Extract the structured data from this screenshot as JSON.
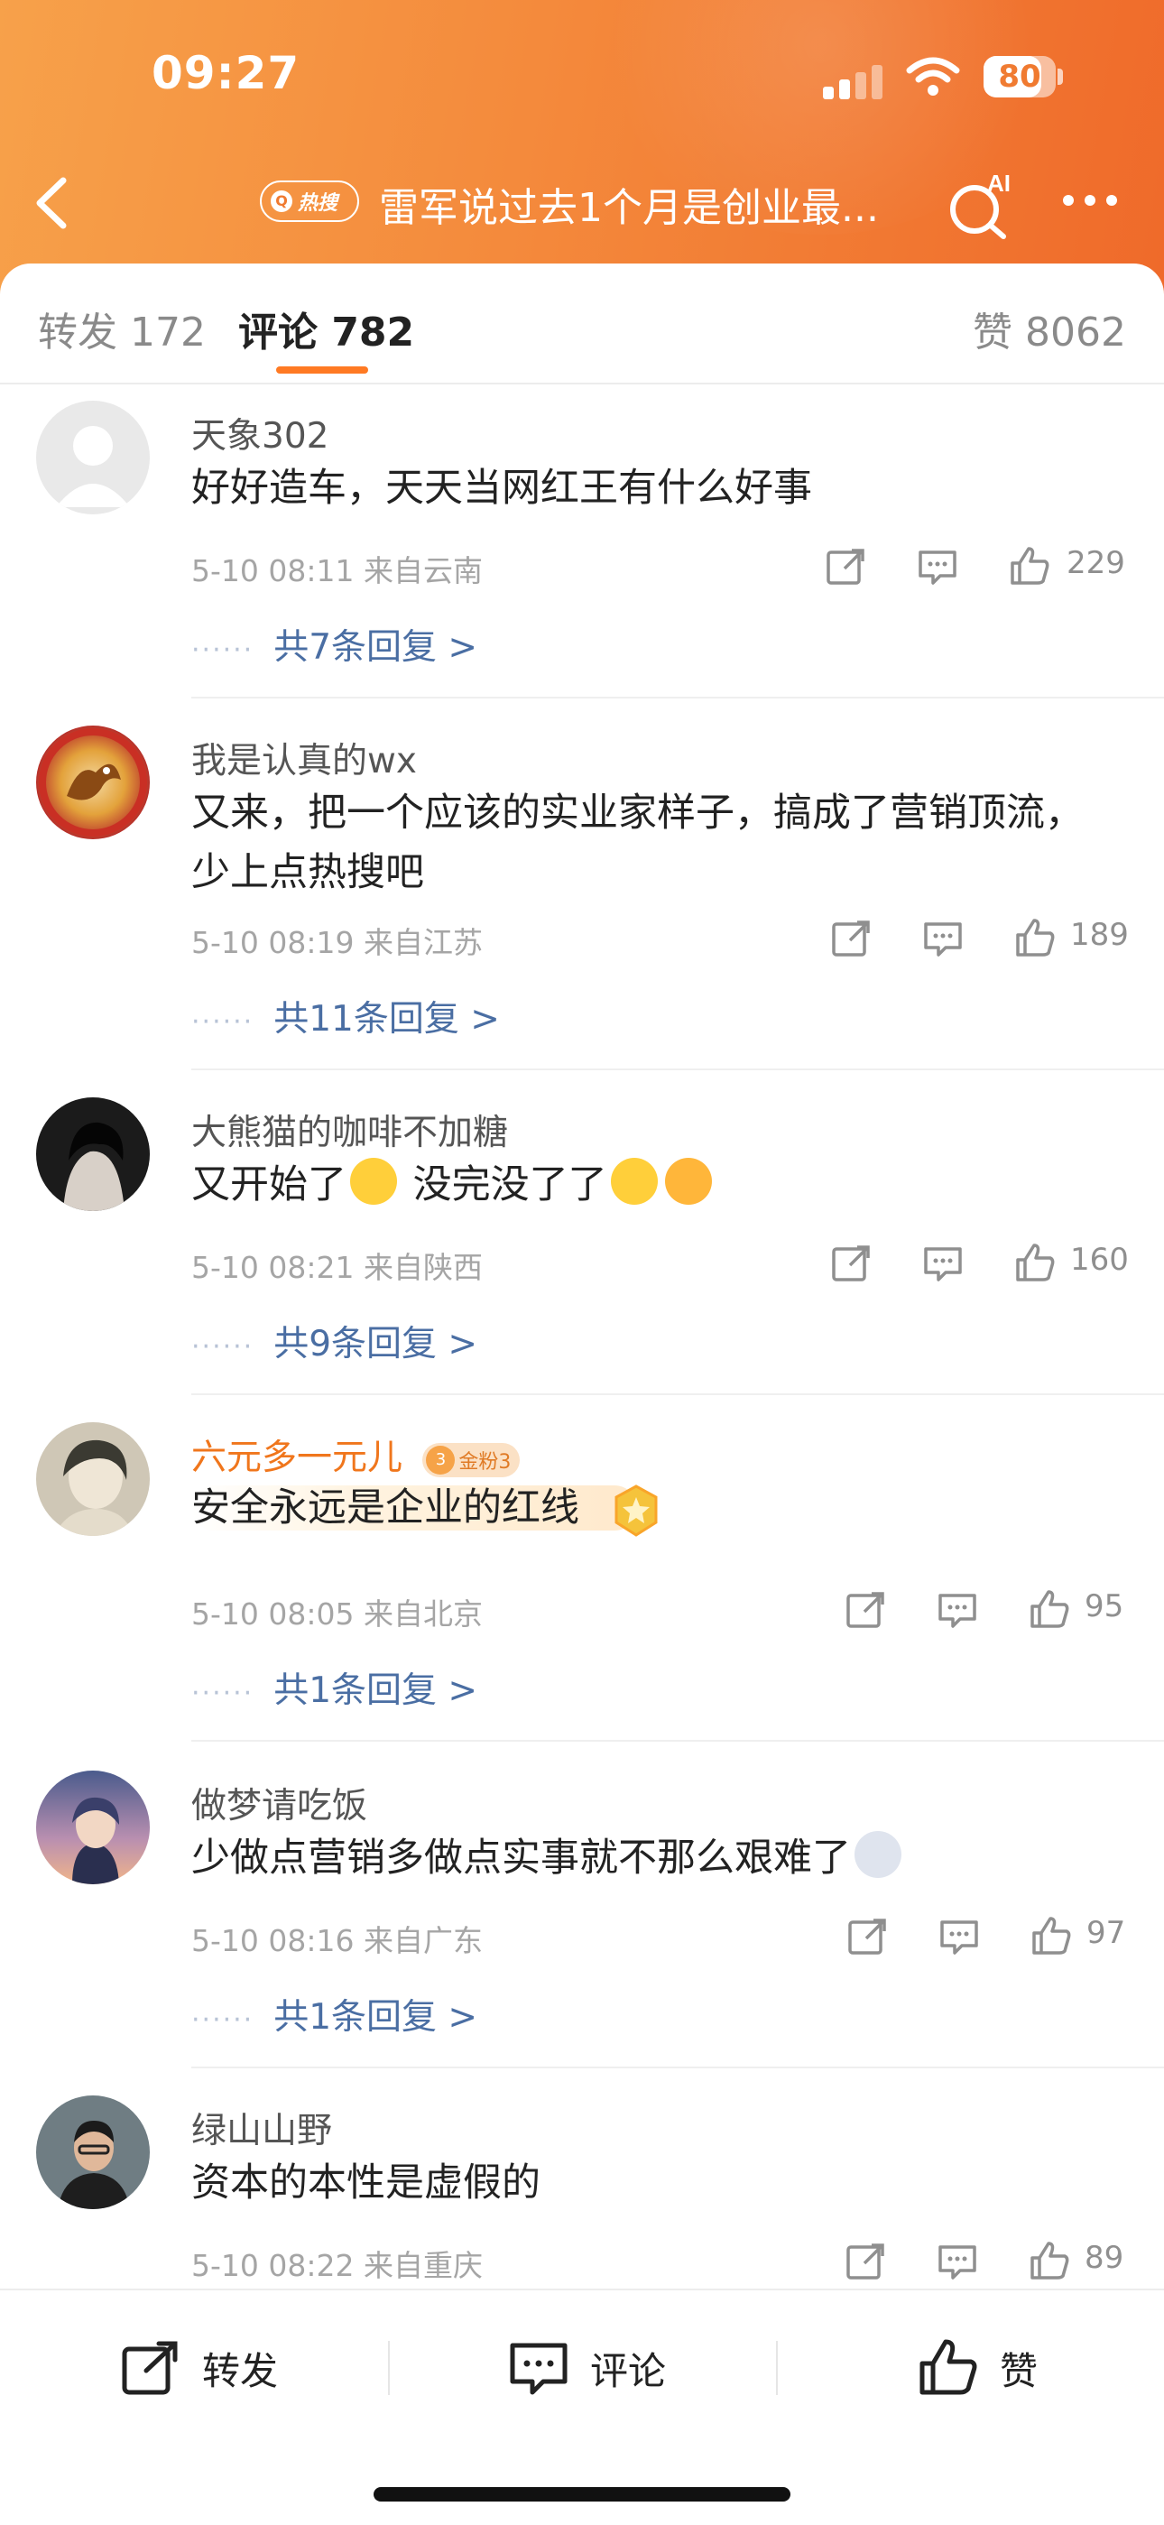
{
  "status_bar": {
    "time": "09:27",
    "battery": "80",
    "battery_fraction": 0.8
  },
  "header": {
    "hot_badge": "热搜",
    "title": "雷军说过去1个月是创业最...",
    "ai_label": "AI"
  },
  "tabs": {
    "repost": "转发 172",
    "comments": "评论 782",
    "likes": "赞 8062"
  },
  "comments": [
    {
      "name": "天象302",
      "text": "好好造车，天天当网红王有什么好事",
      "meta": "5-10 08:11  来自云南",
      "likes": "229",
      "replies": "共7条回复 >"
    },
    {
      "name": "我是认真的wx",
      "text": "又来，把一个应该的实业家样子，搞成了营销顶流，少上点热搜吧",
      "meta": "5-10 08:19  来自江苏",
      "likes": "189",
      "replies": "共11条回复 >"
    },
    {
      "name": "大熊猫的咖啡不加糖",
      "text": "又开始了",
      "text2": "没完没了了",
      "meta": "5-10 08:21  来自陕西",
      "likes": "160",
      "replies": "共9条回复 >"
    },
    {
      "name": "六元多一元儿",
      "badge": "金粉3",
      "text": "安全永远是企业的红线",
      "meta": "5-10 08:05  来自北京",
      "likes": "95",
      "replies": "共1条回复 >"
    },
    {
      "name": "做梦请吃饭",
      "text": "少做点营销多做点实事就不那么艰难了",
      "meta": "5-10 08:16  来自广东",
      "likes": "97",
      "replies": "共1条回复 >"
    },
    {
      "name": "绿山山野",
      "text": "资本的本性是虚假的",
      "meta": "5-10 08:22  来自重庆",
      "likes": "89"
    }
  ],
  "bottom_bar": {
    "repost": "转发",
    "comment": "评论",
    "like": "赞"
  },
  "colors": {
    "header_orange": "#f48a3c",
    "accent": "#ff7a23",
    "link_blue": "#4a6ea3",
    "vip_orange": "#f0761c"
  }
}
